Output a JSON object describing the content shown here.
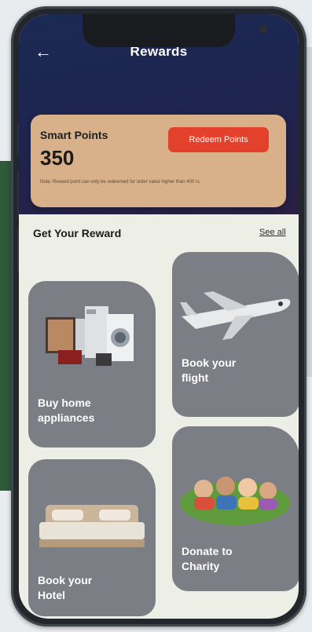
{
  "screen_title": "Rewards",
  "points": {
    "label": "Smart Points",
    "value": "350",
    "redeem_label": "Redeem Points",
    "note": "Note: Reward point can only be redeemed for order value higher than 400 rs."
  },
  "section": {
    "title": "Get Your Reward",
    "see_all": "See all"
  },
  "rewards": [
    {
      "label_line1": "Buy home",
      "label_line2": "appliances",
      "icon": "appliances-icon"
    },
    {
      "label_line1": "Book your",
      "label_line2": "flight",
      "icon": "airplane-icon"
    },
    {
      "label_line1": "Book your",
      "label_line2": "Hotel",
      "icon": "bed-icon"
    },
    {
      "label_line1": "Donate to",
      "label_line2": "Charity",
      "icon": "children-icon"
    }
  ],
  "colors": {
    "header": "#1b2a52",
    "points_card": "#d8b089",
    "redeem_button": "#e4412c",
    "reward_card": "#7b7e84",
    "screen_bg": "#edefe6"
  }
}
